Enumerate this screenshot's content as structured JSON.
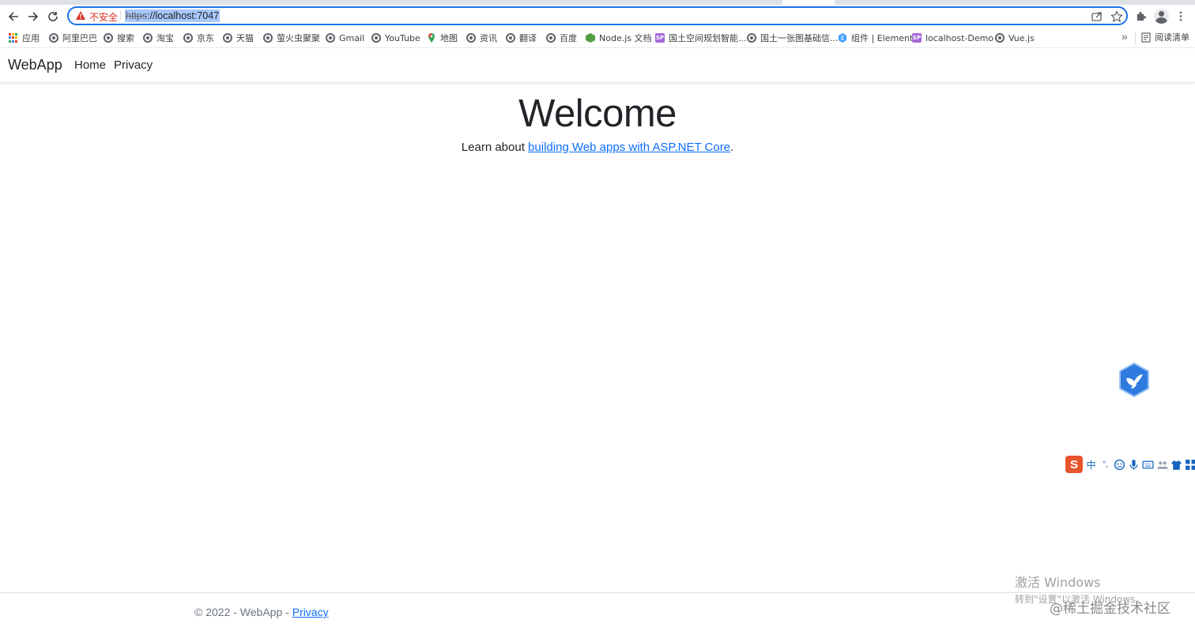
{
  "browser": {
    "insecure_label": "不安全",
    "url_scheme": "https",
    "url_rest": "://localhost:7047",
    "bookmarks": [
      {
        "label": "应用",
        "icon": "apps-grid-icon"
      },
      {
        "label": "阿里巴巴",
        "icon": "globe-icon"
      },
      {
        "label": "搜索",
        "icon": "globe-icon"
      },
      {
        "label": "淘宝",
        "icon": "globe-icon"
      },
      {
        "label": "京东",
        "icon": "globe-icon"
      },
      {
        "label": "天猫",
        "icon": "globe-icon"
      },
      {
        "label": "萤火虫聚聚",
        "icon": "globe-icon"
      },
      {
        "label": "Gmail",
        "icon": "globe-icon"
      },
      {
        "label": "YouTube",
        "icon": "globe-icon"
      },
      {
        "label": "地图",
        "icon": "maps-icon"
      },
      {
        "label": "资讯",
        "icon": "globe-icon"
      },
      {
        "label": "翻译",
        "icon": "globe-icon"
      },
      {
        "label": "百度",
        "icon": "globe-icon"
      },
      {
        "label": "Node.js 文档",
        "icon": "nodejs-icon"
      },
      {
        "label": "国土空间规划智能...",
        "icon": "sp-badge-icon"
      },
      {
        "label": "国土一张图基础信...",
        "icon": "globe-icon"
      },
      {
        "label": "组件 | Element",
        "icon": "element-icon"
      },
      {
        "label": "localhost-Demo",
        "icon": "sp-badge-icon"
      },
      {
        "label": "Vue.js",
        "icon": "globe-icon"
      }
    ],
    "overflow_label": "»",
    "reading_list_label": "阅读清单"
  },
  "site": {
    "brand": "WebApp",
    "nav": [
      {
        "label": "Home"
      },
      {
        "label": "Privacy"
      }
    ],
    "heading": "Welcome",
    "lead_prefix": "Learn about ",
    "lead_link": "building Web apps with ASP.NET Core",
    "lead_suffix": ".",
    "footer_text": "© 2022 - WebApp - ",
    "footer_link": "Privacy"
  },
  "ime": {
    "logo": "S",
    "mode": "中",
    "punct": "°,"
  },
  "overlay": {
    "activate_title": "激活 Windows",
    "activate_sub": "转到\"设置\"以激活 Windows。",
    "juejin": "@稀土掘金技术社区"
  },
  "colors": {
    "link": "#0d6efd",
    "omnibox_border": "#1a73e8",
    "warning": "#d93025"
  }
}
